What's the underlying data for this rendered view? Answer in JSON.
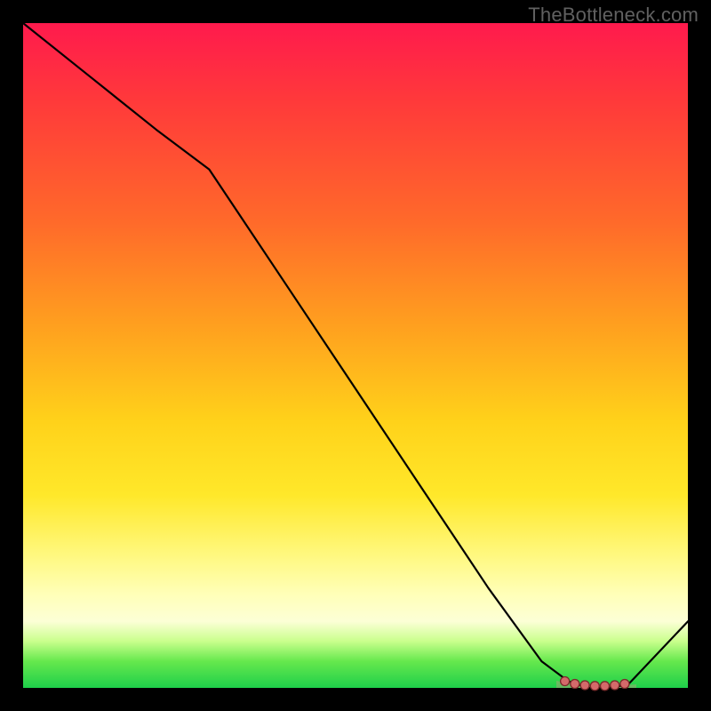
{
  "attribution": {
    "watermark": "TheBottleneck.com"
  },
  "colors": {
    "background": "#000000",
    "gradient_top": "#ff1a4d",
    "gradient_bottom": "#1ecf4a",
    "curve": "#000000",
    "marker_fill": "#d46a6a",
    "marker_stroke": "#7a2a2a"
  },
  "chart_data": {
    "type": "line",
    "title": "",
    "xlabel": "",
    "ylabel": "",
    "xlim": [
      0,
      100
    ],
    "ylim": [
      0,
      100
    ],
    "grid": false,
    "legend": "none",
    "series": [
      {
        "name": "curve",
        "x": [
          0,
          10,
          20,
          28,
          40,
          50,
          60,
          70,
          78,
          82,
          85,
          88,
          91,
          100
        ],
        "values": [
          100,
          92,
          84,
          78,
          60,
          45,
          30,
          15,
          4,
          1,
          0,
          0,
          0.5,
          10
        ]
      }
    ],
    "markers": [
      {
        "x": 81.5,
        "y": 1.0
      },
      {
        "x": 83.0,
        "y": 0.6
      },
      {
        "x": 84.5,
        "y": 0.4
      },
      {
        "x": 86.0,
        "y": 0.3
      },
      {
        "x": 87.5,
        "y": 0.3
      },
      {
        "x": 89.0,
        "y": 0.4
      },
      {
        "x": 90.5,
        "y": 0.6
      }
    ],
    "notes": "Values are estimated from pixels on an unlabeled bottleneck-style chart. y=0 is at the bottom (green band), y=100 at the top (red band). The curve descends steeply, has a flat minimum near x≈82–91, then kicks up toward the right edge."
  }
}
